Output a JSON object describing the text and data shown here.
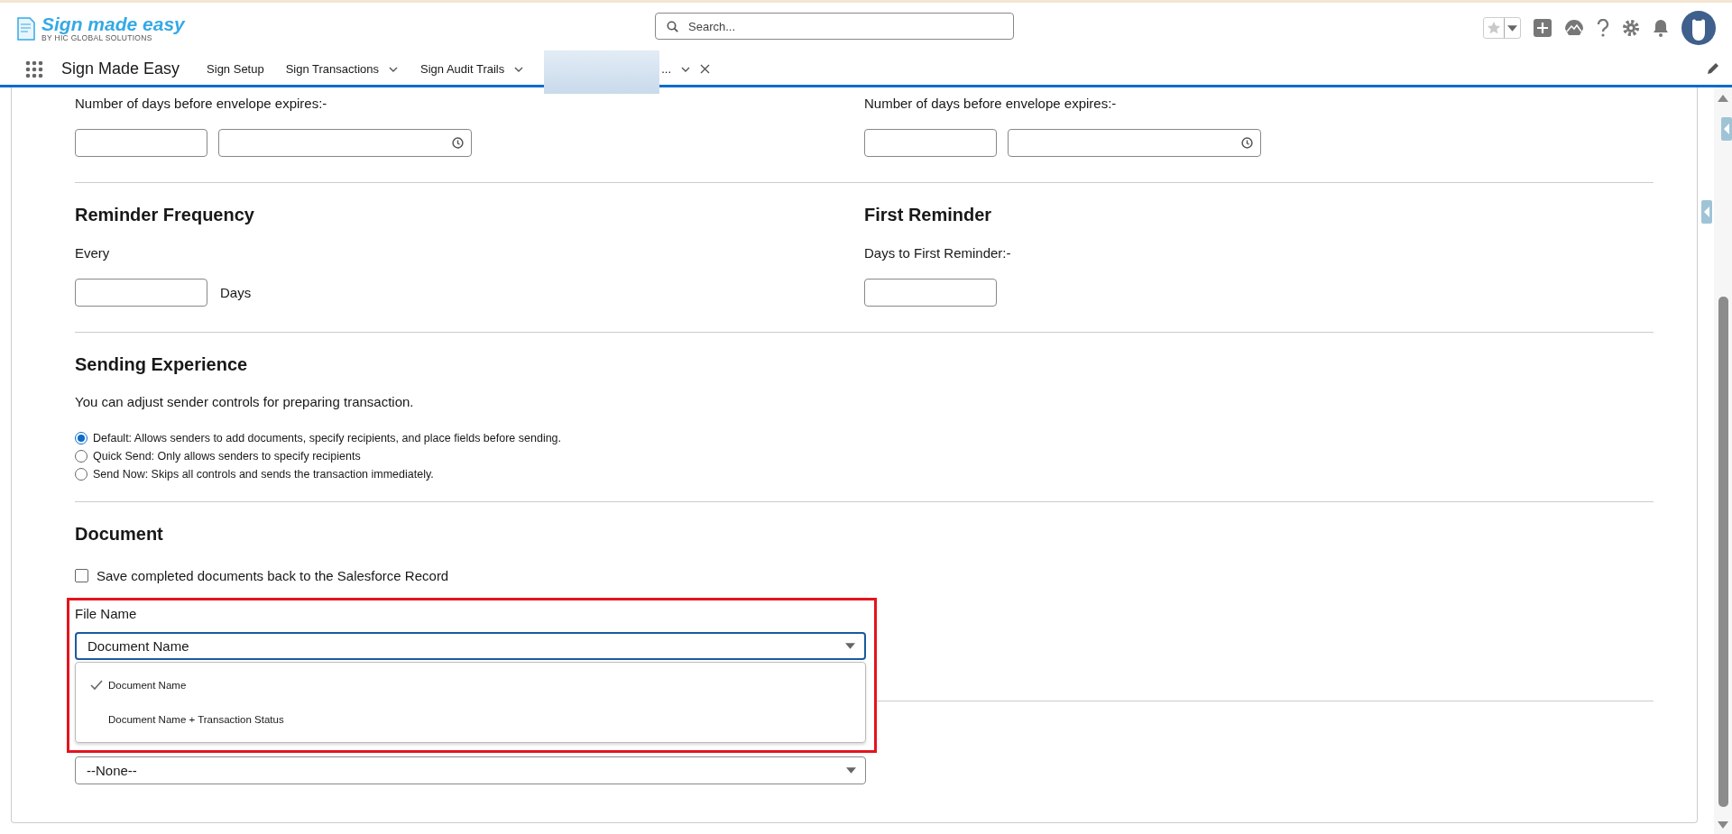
{
  "header": {
    "logo_title": "Sign made easy",
    "logo_subtitle": "BY HIC GLOBAL SOLUTIONS",
    "search": {
      "placeholder": "Search..."
    }
  },
  "nav": {
    "app_name": "Sign Made Easy",
    "tabs": [
      {
        "label": "Sign Setup",
        "kind": "plain"
      },
      {
        "label": "Sign Transactions",
        "kind": "menu"
      },
      {
        "label": "Sign Audit Trails",
        "kind": "menu"
      },
      {
        "label": "...",
        "kind": "record"
      }
    ]
  },
  "expiry": [
    {
      "label": "Number of days before envelope expires:-"
    },
    {
      "label": "Number of days before envelope expires:-"
    }
  ],
  "reminder_frequency": {
    "heading": "Reminder Frequency",
    "label": "Every",
    "unit": "Days"
  },
  "first_reminder": {
    "heading": "First Reminder",
    "label": "Days to First Reminder:-"
  },
  "sending_experience": {
    "heading": "Sending Experience",
    "description": "You can adjust sender controls for preparing transaction.",
    "options": [
      {
        "label": "Default: Allows senders to add documents, specify recipients, and place fields before sending.",
        "selected": true
      },
      {
        "label": "Quick Send: Only allows senders to specify recipients",
        "selected": false
      },
      {
        "label": "Send Now: Skips all controls and sends the transaction immediately.",
        "selected": false
      }
    ]
  },
  "document": {
    "heading": "Document",
    "save_back": {
      "label": "Save completed documents back to the Salesforce Record",
      "checked": false
    },
    "file_name": {
      "label": "File Name",
      "value": "Document Name",
      "expanded": true,
      "highlighted": true,
      "options": [
        {
          "label": "Document Name",
          "selected": true
        },
        {
          "label": "Document Name + Transaction Status",
          "selected": false
        }
      ]
    },
    "second_select": {
      "value": "--None--"
    }
  }
}
